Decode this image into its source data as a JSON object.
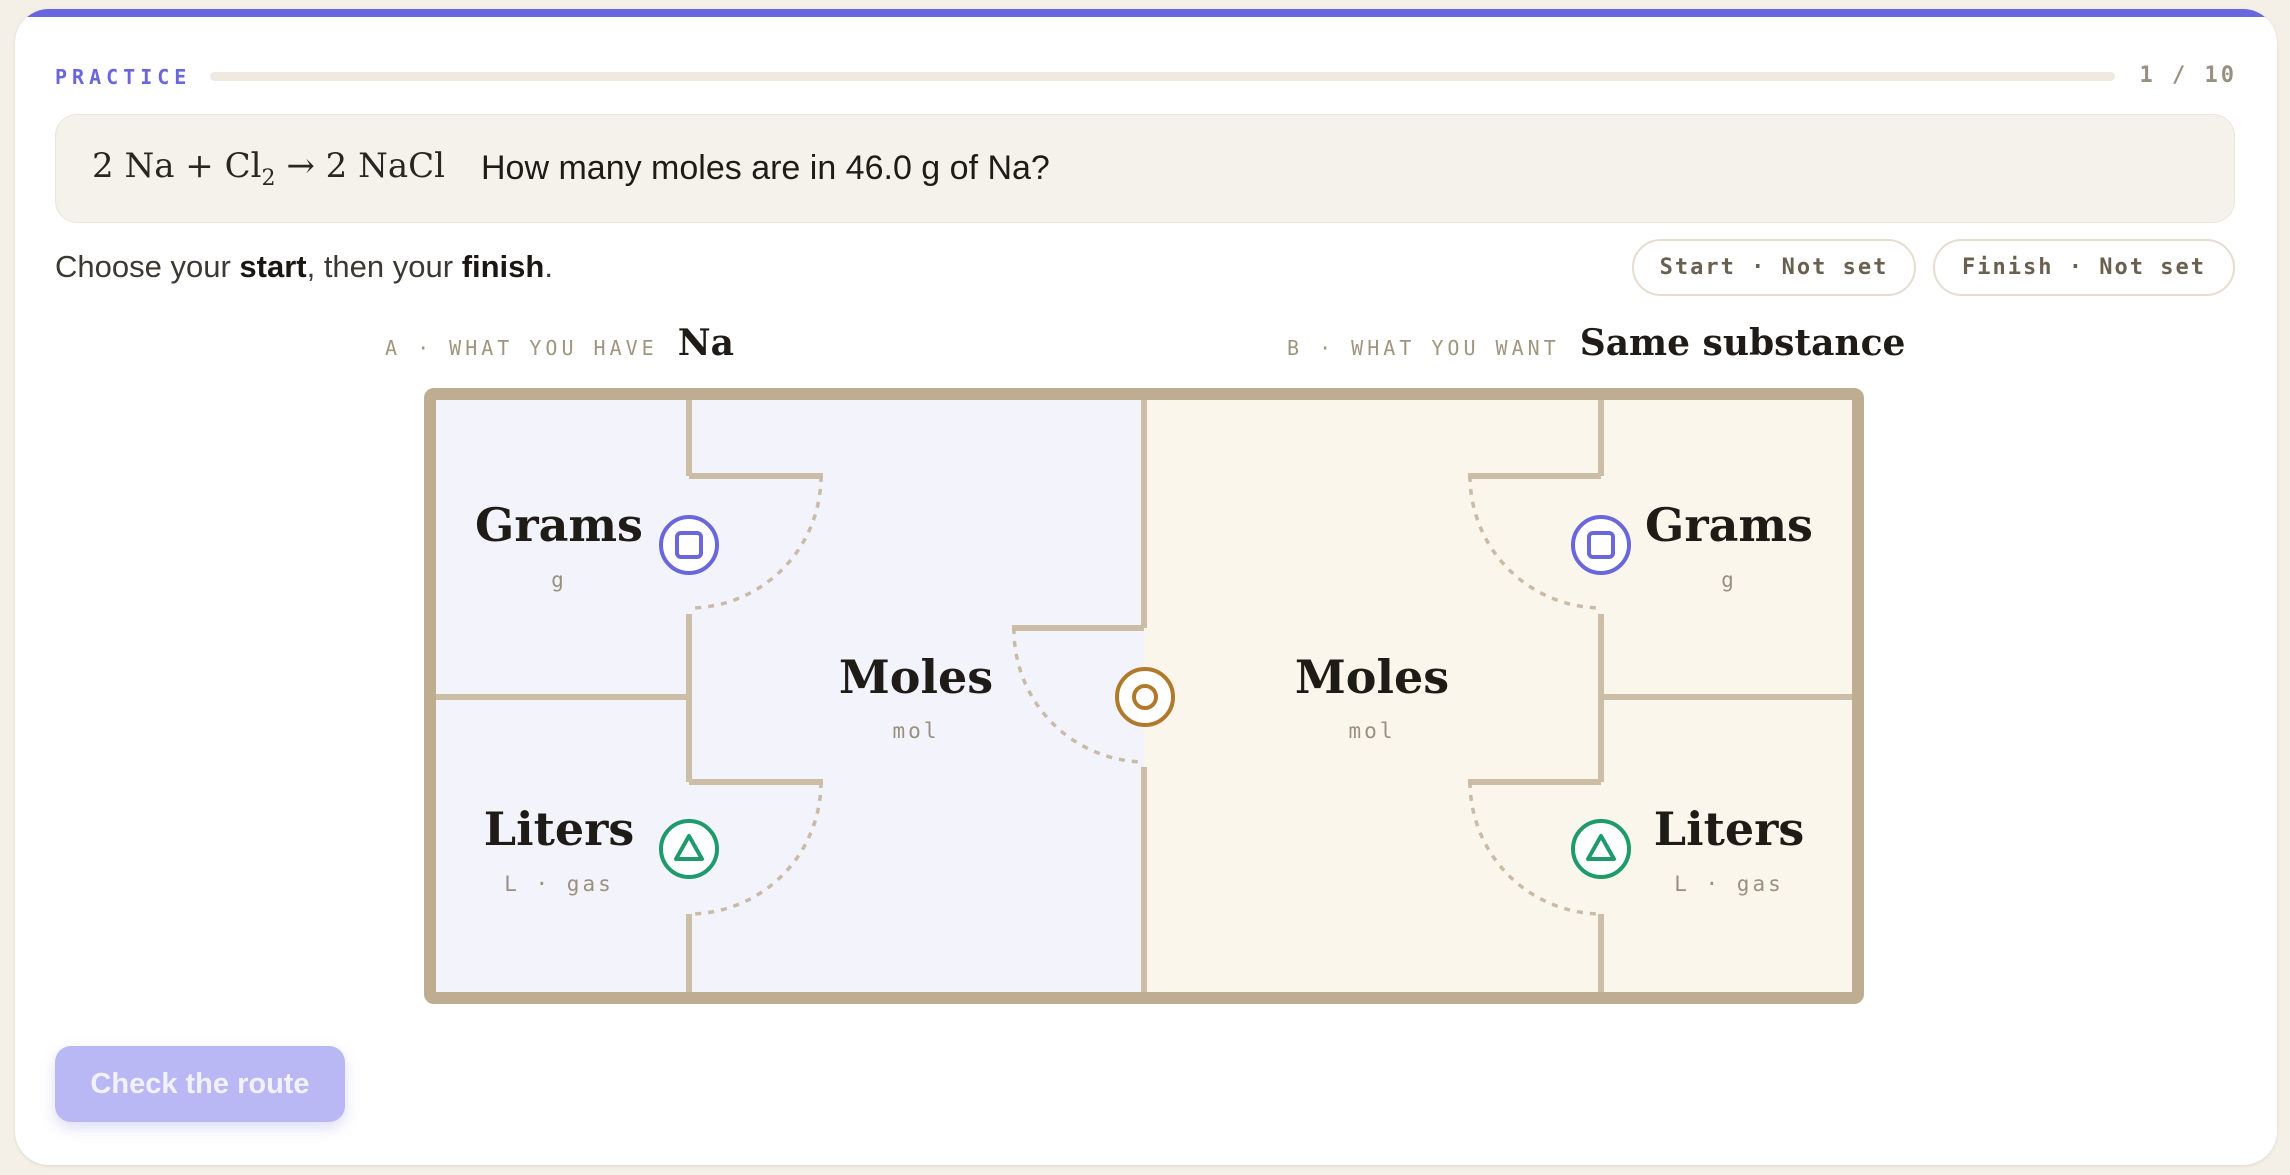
{
  "header": {
    "mode_label": "PRACTICE",
    "progress_text": "1 / 10",
    "progress_fraction": 0.1,
    "accent_color": "#6a66dc"
  },
  "question": {
    "equation": {
      "coef1": "2",
      "reactant1": "Na",
      "plus": "+",
      "reactant2": "Cl",
      "reactant2_sub": "2",
      "arrow": "→",
      "coef2": "2",
      "product": "NaCl"
    },
    "text": "How many moles are in 46.0 g of Na?"
  },
  "instruction": {
    "pre": "Choose your ",
    "start_word": "start",
    "mid": ", then your ",
    "finish_word": "finish",
    "post": "."
  },
  "selection": {
    "start_label": "Start · Not set",
    "finish_label": "Finish · Not set"
  },
  "side_a": {
    "caption": "A · WHAT YOU HAVE",
    "substance": "Na",
    "room_color": "#f3f3fc"
  },
  "side_b": {
    "caption": "B · WHAT YOU WANT",
    "substance": "Same substance",
    "room_color": "#faf6ec"
  },
  "rooms": {
    "a_grams": {
      "name": "Grams",
      "unit": "g",
      "icon": "square-in-circle-icon",
      "icon_color": "#6a66dc"
    },
    "a_liters": {
      "name": "Liters",
      "unit": "L · gas",
      "icon": "triangle-in-circle-icon",
      "icon_color": "#1f9a6a"
    },
    "a_moles": {
      "name": "Moles",
      "unit": "mol"
    },
    "center_door": {
      "icon": "ring-in-circle-icon",
      "icon_color": "#b07a2a"
    },
    "b_moles": {
      "name": "Moles",
      "unit": "mol"
    },
    "b_grams": {
      "name": "Grams",
      "unit": "g",
      "icon": "square-in-circle-icon",
      "icon_color": "#6a66dc"
    },
    "b_liters": {
      "name": "Liters",
      "unit": "L · gas",
      "icon": "triangle-in-circle-icon",
      "icon_color": "#1f9a6a"
    }
  },
  "walls_color": "#bfad92",
  "actions": {
    "check_label": "Check the route"
  }
}
